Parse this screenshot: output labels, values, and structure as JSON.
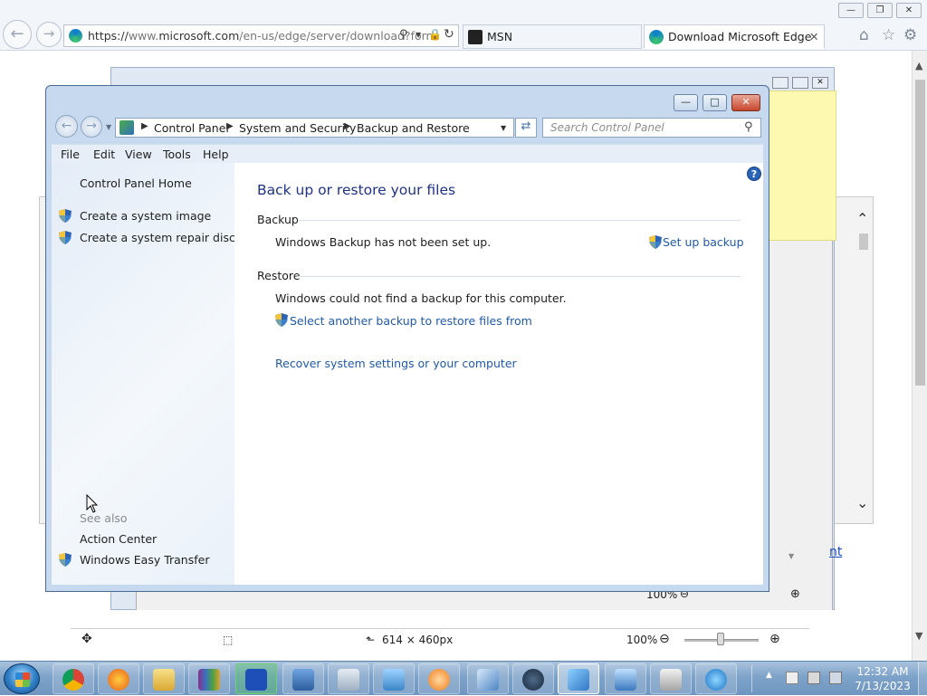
{
  "browser": {
    "address": "https://www.microsoft.com/en-us/edge/server/download?form",
    "address_scheme": "https://",
    "address_rest": "www.microsoft.com/en-us/edge/server/download?form",
    "tabs": [
      {
        "label": "MSN"
      },
      {
        "label": "Download Microsoft Edge"
      }
    ],
    "active_tab_close": "✕"
  },
  "control_panel": {
    "breadcrumb": [
      "Control Panel",
      "System and Security",
      "Backup and Restore"
    ],
    "search_placeholder": "Search Control Panel",
    "menu": [
      "File",
      "Edit",
      "View",
      "Tools",
      "Help"
    ],
    "left": {
      "home": "Control Panel Home",
      "tasks": [
        "Create a system image",
        "Create a system repair disc"
      ],
      "see_also_heading": "See also",
      "see_also": [
        "Action Center",
        "Windows Easy Transfer"
      ]
    },
    "main": {
      "title": "Back up or restore your files",
      "backup_heading": "Backup",
      "backup_status": "Windows Backup has not been set up.",
      "setup_link": "Set up backup",
      "restore_heading": "Restore",
      "restore_status": "Windows could not find a backup for this computer.",
      "select_backup_link": "Select another backup to restore files from",
      "recover_link": "Recover system settings or your computer"
    }
  },
  "background": {
    "partial_link": "nt",
    "zoom_behind": "100%"
  },
  "statusbar": {
    "dimensions": "614 × 460px",
    "zoom": "100%"
  },
  "taskbar": {
    "time": "12:32 AM",
    "date": "7/13/2023",
    "apps": [
      "chrome-icon",
      "firefox-icon",
      "file-explorer-icon",
      "winrar-icon",
      "malwarebytes-icon",
      "network-icon",
      "calculator-icon",
      "mail-icon",
      "media-player-icon",
      "paint-icon",
      "steam-icon",
      "control-panel-icon",
      "remote-desktop-icon",
      "printer-icon",
      "internet-explorer-icon"
    ]
  },
  "colors": {
    "link": "#1f5aa8",
    "title": "#1e3287",
    "taskbar": "#7ea3c9"
  }
}
